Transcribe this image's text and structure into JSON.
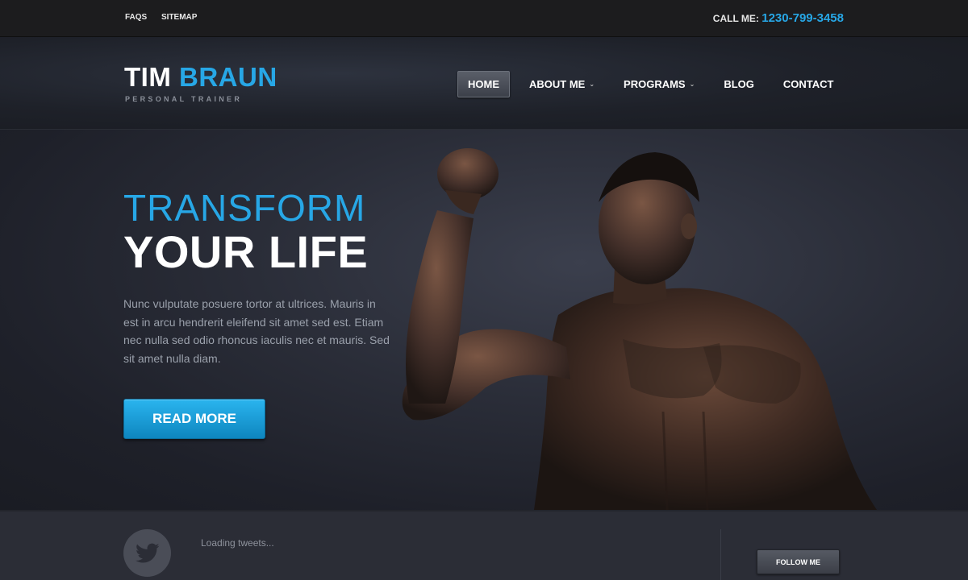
{
  "topbar": {
    "links": [
      "FAQS",
      "SITEMAP"
    ],
    "call_label": "CALL ME:",
    "phone": "1230-799-3458"
  },
  "header": {
    "logo_first": "TIM",
    "logo_last": "BRAUN",
    "tagline": "PERSONAL TRAINER",
    "nav": [
      {
        "label": "HOME",
        "active": true
      },
      {
        "label": "ABOUT ME",
        "dropdown": true
      },
      {
        "label": "PROGRAMS",
        "dropdown": true
      },
      {
        "label": "BLOG"
      },
      {
        "label": "CONTACT"
      }
    ]
  },
  "hero": {
    "title_line1": "TRANSFORM",
    "title_line2": "YOUR LIFE",
    "text": "Nunc vulputate posuere tortor at ultrices. Mauris in est in arcu hendrerit eleifend sit amet sed est. Etiam nec nulla sed odio rhoncus iaculis nec et mauris. Sed sit amet nulla diam.",
    "button": "READ MORE"
  },
  "twitter": {
    "status": "Loading tweets...",
    "follow": "FOLLOW ME",
    "icon": "twitter-bird-icon"
  },
  "colors": {
    "accent": "#27a7e6",
    "background": "#1b1d24"
  }
}
